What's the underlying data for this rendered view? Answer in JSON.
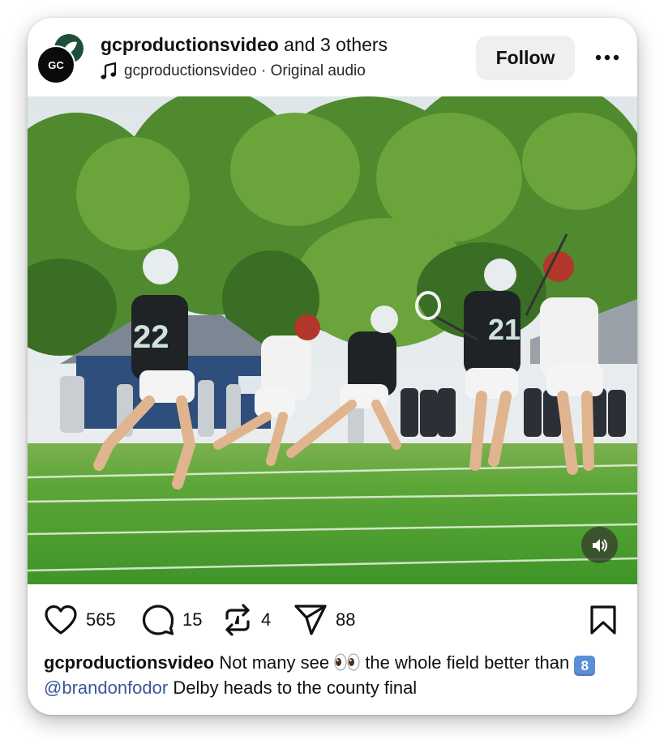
{
  "post": {
    "username": "gcproductionsvideo",
    "coauthors": " and 3 others",
    "avatar_text": "GC",
    "audio": {
      "icon": "music-note-icon",
      "artist": "gcproductionsvideo",
      "separator": " · ",
      "track": "Original audio"
    },
    "follow_label": "Follow",
    "more_icon": "more-dots-icon"
  },
  "media": {
    "description": "lacrosse-game-video",
    "jerseys": [
      "22",
      "21"
    ],
    "sound_icon": "volume-icon"
  },
  "actions": {
    "likes": "565",
    "comments": "15",
    "reposts": "4",
    "shares": "88"
  },
  "caption": {
    "username": "gcproductionsvideo",
    "text_1": " Not many see ",
    "text_2": " the whole field better than ",
    "keycap": "8",
    "mention": "@brandonfodor",
    "text_3": " Delby heads to the county final"
  },
  "colors": {
    "mention": "#385898",
    "follow_bg": "#efefef",
    "field": "#5ca637"
  }
}
